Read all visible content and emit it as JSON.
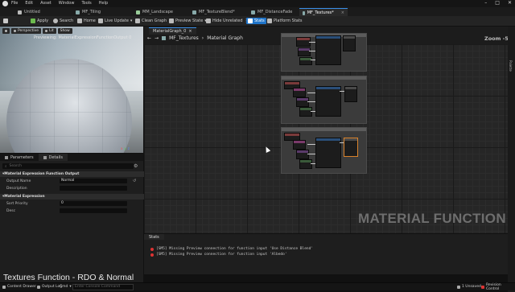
{
  "menubar": {
    "items": [
      "File",
      "Edit",
      "Asset",
      "Window",
      "Tools",
      "Help"
    ],
    "window_controls": [
      "–",
      "□",
      "✕"
    ]
  },
  "tabs": [
    {
      "label": "Untitled",
      "active": false
    },
    {
      "label": "MF_Tiling",
      "active": false
    },
    {
      "label": "MM_Landscape",
      "active": false
    },
    {
      "label": "MF_TextureBlend*",
      "active": false
    },
    {
      "label": "MF_DistanceFade",
      "active": false
    },
    {
      "label": "MF_Textures*",
      "active": true
    }
  ],
  "toolbar": {
    "save": "Save",
    "apply": "Apply",
    "search": "Search",
    "home": "Home",
    "live_update": "Live Update",
    "clean_graph": "Clean Graph",
    "preview_state": "Preview State",
    "hide_unrelated": "Hide Unrelated",
    "stats": "Stats",
    "platform_stats": "Platform Stats"
  },
  "viewport": {
    "perspective": "Perspective",
    "lit": "Lit",
    "show": "Show",
    "previewing": "Previewing: MaterialExpressionFunctionOutput 0",
    "axis": [
      "x",
      "y",
      "z"
    ]
  },
  "details": {
    "tabs": [
      "Parameters",
      "Details"
    ],
    "search_placeholder": "Search",
    "categories": [
      {
        "title": "Material Expression Function Output",
        "rows": [
          {
            "label": "Output Name",
            "value": "Normal"
          },
          {
            "label": "Description",
            "value": ""
          }
        ]
      },
      {
        "title": "Material Expression",
        "rows": [
          {
            "label": "Sort Priority",
            "value": "0"
          },
          {
            "label": "Desc",
            "value": ""
          }
        ]
      }
    ]
  },
  "graph": {
    "tab_label": "MaterialGraph_0",
    "breadcrumb": [
      "MF_Textures",
      "Material Graph"
    ],
    "zoom": "Zoom -5",
    "watermark": "MATERIAL FUNCTION",
    "right_strip_label": "Palette"
  },
  "stats": {
    "tab": "Stats",
    "messages": [
      "[SM5] Missing Preview connection for function input 'Use Distance Blend'",
      "[SM5] Missing Preview connection for function input 'Albedo'"
    ]
  },
  "caption": "Textures Function - RDO & Normal",
  "statusbar": {
    "content_drawer": "Content Drawer",
    "output_log": "Output Log",
    "cmd": "Cmd",
    "cmd_placeholder": "Enter Console Command",
    "unsaved": "1 Unsaved",
    "revision_control": "Revision Control"
  },
  "colors": {
    "accent": "#1f74c9",
    "error": "#dd3333",
    "watermark": "#6e6e6e"
  }
}
